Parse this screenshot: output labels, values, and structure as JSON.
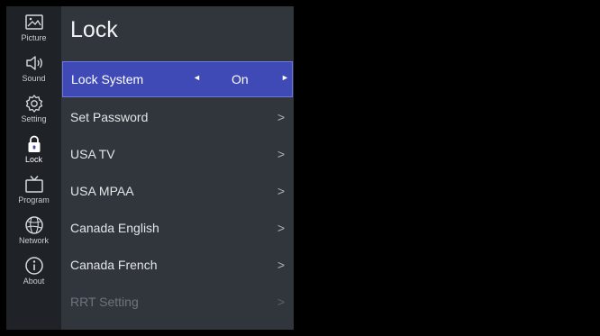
{
  "sidebar": {
    "items": [
      {
        "label": "Picture",
        "icon": "picture-icon"
      },
      {
        "label": "Sound",
        "icon": "speaker-icon"
      },
      {
        "label": "Setting",
        "icon": "gear-icon"
      },
      {
        "label": "Lock",
        "icon": "lock-icon",
        "active": true
      },
      {
        "label": "Program",
        "icon": "tv-icon"
      },
      {
        "label": "Network",
        "icon": "network-icon"
      },
      {
        "label": "About",
        "icon": "info-icon"
      }
    ]
  },
  "panel": {
    "title": "Lock",
    "rows": [
      {
        "label": "Lock System",
        "value": "On",
        "left_arrow": "◄",
        "right_arrow": "►"
      },
      {
        "label": "Set Password",
        "chevron": ">"
      },
      {
        "label": "USA TV",
        "chevron": ">"
      },
      {
        "label": "USA MPAA",
        "chevron": ">"
      },
      {
        "label": "Canada English",
        "chevron": ">"
      },
      {
        "label": "Canada French",
        "chevron": ">"
      },
      {
        "label": "RRT Setting",
        "chevron": ">",
        "disabled": true
      }
    ]
  },
  "colors": {
    "sidebar_bg": "#1f2227",
    "panel_bg": "#31363c",
    "selected_bg": "#3f4ab7",
    "active_icon": "#ffffff"
  }
}
